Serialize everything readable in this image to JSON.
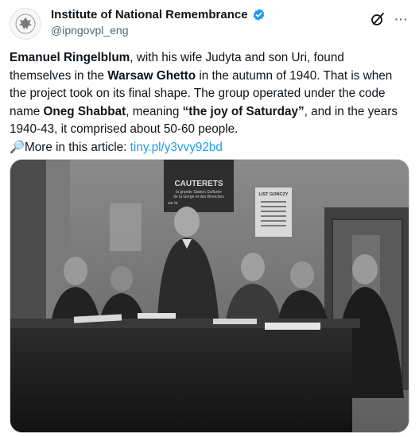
{
  "account": {
    "name": "Institute of National Remembrance",
    "handle": "@ipngovpl_eng",
    "verified_color": "#1d9bf0"
  },
  "actions": {
    "grok_icon": "grok-icon",
    "more_icon": "more-icon",
    "more_label": "···"
  },
  "tweet": {
    "p1_bold": "Emanuel Ringelblum",
    "p1_a": ", with his wife Judyta and son Uri, found themselves in the ",
    "p1_bold2": "Warsaw Ghetto",
    "p1_b": " in the autumn of 1940. That is when the project took on its final shape. The group operated under the code name ",
    "p1_bold3": "Oneg Shabbat",
    "p1_c": ", meaning ",
    "p1_bold4": "“the joy of Saturday”",
    "p1_d": ", and in the years 1940-43, it comprised about 50-60 people.",
    "more_prefix": "🔎More in this article: ",
    "link": "tiny.pl/y3vvy92bd",
    "link_color": "#1d9bf0"
  },
  "photo": {
    "poster_title": "CAUTERETS",
    "poster_line1": "la grande Station Sulfurée",
    "poster_line2": "de la Gorge et des Bronches",
    "poster_small": "sur la",
    "notice_title": "LIST GOŃCZY"
  }
}
